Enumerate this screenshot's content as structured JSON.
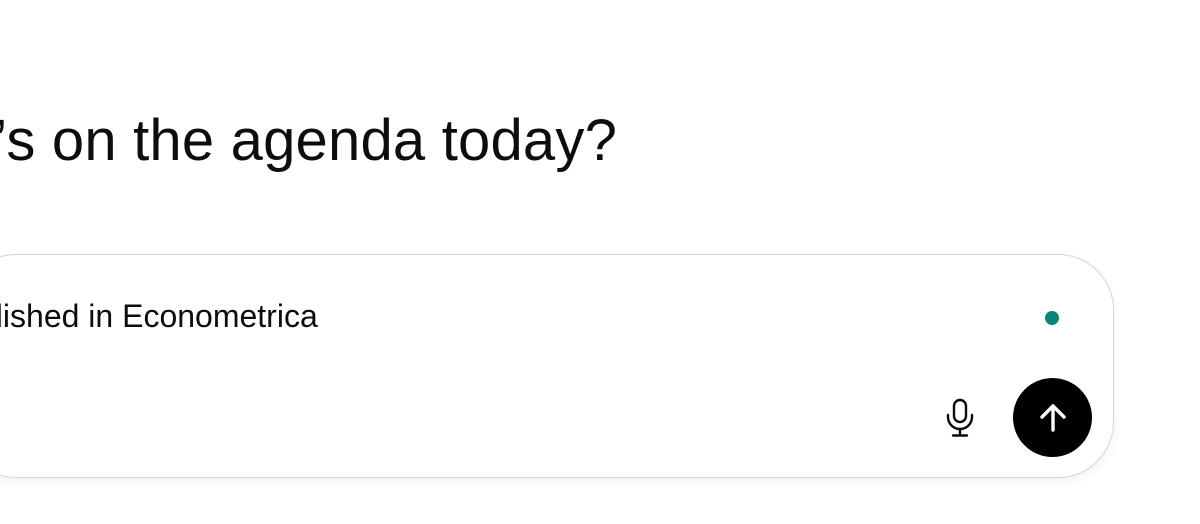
{
  "main": {
    "heading": "t’s on the agenda today?"
  },
  "composer": {
    "input_text": "blished in Econometrica",
    "status_dot_color": "#0b8377",
    "mic_icon": "microphone-icon",
    "send_icon": "arrow-up-icon",
    "send_button_color": "#000000"
  }
}
